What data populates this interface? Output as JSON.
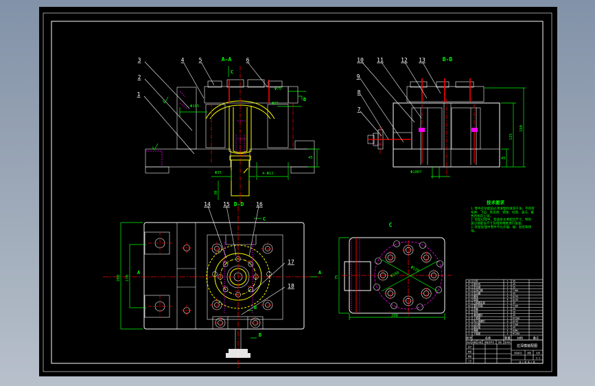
{
  "app": {
    "kind": "CAD assembly drawing preview",
    "background": "blue-gray",
    "canvas": "black"
  },
  "palette": {
    "green": "#00ff00",
    "red": "#ff0000",
    "yellow": "#ffff00",
    "cyan": "#00e8e8",
    "magenta": "#ff00ff",
    "white": "#ffffff",
    "bg_top": "#8292a8",
    "bg_bottom": "#b7c0cb",
    "canvas": "#000000"
  },
  "callouts": {
    "c1": "1",
    "c2": "2",
    "c3": "3",
    "c4": "4",
    "c5": "5",
    "c6": "6",
    "c7": "7",
    "c8": "8",
    "c9": "9",
    "c10": "10",
    "c11": "11",
    "c12": "12",
    "c13": "13",
    "c14": "14",
    "c15": "15",
    "c16": "16",
    "c17": "17",
    "c18": "18"
  },
  "section_labels": {
    "aa": "A-A",
    "bb": "B-B",
    "dd": "D-D",
    "view_c": "C",
    "cut_c_top": "C",
    "cut_c_plan": "C",
    "cut_a_left": "A",
    "cut_a_right": "A",
    "cut_b_1": "B",
    "cut_b_2": "B",
    "cut_b_aa": "B"
  },
  "dimensions": {
    "aa_bore": "Φ105",
    "aa_flange": "Φ75",
    "aa_inner": "Φ25",
    "aa_shank": "Φ35",
    "aa_holes": "4-Φ12",
    "aa_step": "45",
    "aa_shank_len": "30",
    "bb_height1": "125",
    "bb_height2": "190",
    "bb_step": "45",
    "bb_pin": "Φ10H7",
    "plan_width": "280",
    "plan_inner": "170",
    "c_bolt_circle1": "Φ160",
    "c_bolt_circle2": "Φ128",
    "c_side": "75",
    "c_length": "208"
  },
  "notes": {
    "title": "技术要求",
    "lines": [
      "1.零件在装配前必须清理和清洗干净，不得有",
      "毛刺、飞边、氧化皮、锈蚀、切屑、油污、着",
      "色剂和灰尘等。",
      "2.装配过程中，检查各主要配合尺寸，特别",
      "是过渡配合尺寸及相关精度进行复查。",
      "3.装配处理中零件不允许磕、碰、划伤和锈",
      "蚀。"
    ]
  },
  "bom": {
    "headers": {
      "no": "序号",
      "name": "名称",
      "qty": "数量",
      "mat": "材料",
      "note": "备注"
    },
    "rows": [
      {
        "no": "18",
        "name": "打杆",
        "qty": "1",
        "mat": "45",
        "note": ""
      },
      {
        "no": "17",
        "name": "推件块",
        "qty": "1",
        "mat": "45",
        "note": ""
      },
      {
        "no": "16",
        "name": "定位销",
        "qty": "2",
        "mat": "35",
        "note": ""
      },
      {
        "no": "15",
        "name": "拉深凸模",
        "qty": "1",
        "mat": "T10A",
        "note": ""
      },
      {
        "no": "14",
        "name": "压边圈",
        "qty": "1",
        "mat": "45",
        "note": ""
      },
      {
        "no": "13",
        "name": "螺母",
        "qty": "4",
        "mat": "Q235",
        "note": ""
      },
      {
        "no": "12",
        "name": "垫圈",
        "qty": "4",
        "mat": "Q235",
        "note": ""
      },
      {
        "no": "11",
        "name": "凸模固定板",
        "qty": "1",
        "mat": "45",
        "note": ""
      },
      {
        "no": "10",
        "name": "落料凹模",
        "qty": "1",
        "mat": "T10A",
        "note": ""
      },
      {
        "no": "9",
        "name": "导套",
        "qty": "2",
        "mat": "20",
        "note": ""
      },
      {
        "no": "8",
        "name": "导柱",
        "qty": "2",
        "mat": "20",
        "note": ""
      },
      {
        "no": "7",
        "name": "紧固螺钉",
        "qty": "1",
        "mat": "45",
        "note": ""
      },
      {
        "no": "6",
        "name": "上模座",
        "qty": "1",
        "mat": "HT200",
        "note": ""
      },
      {
        "no": "5",
        "name": "内六角螺钉",
        "qty": "4",
        "mat": "Q235",
        "note": ""
      },
      {
        "no": "4",
        "name": "凸凹模",
        "qty": "1",
        "mat": "T10A",
        "note": ""
      },
      {
        "no": "3",
        "name": "固定板",
        "qty": "1",
        "mat": "45",
        "note": ""
      },
      {
        "no": "2",
        "name": "弹簧",
        "qty": "4",
        "mat": "65Mn",
        "note": ""
      },
      {
        "no": "1",
        "name": "下模座",
        "qty": "1",
        "mat": "HT200",
        "note": ""
      }
    ]
  },
  "title_block": {
    "rev": [
      "标记",
      "处数",
      "分区",
      "更改文件号",
      "签名",
      "年月日"
    ],
    "roles": [
      "设计",
      "校核",
      "审核",
      "工艺"
    ],
    "drawing_name": "拉深模装配图",
    "stage_label": "阶段标记",
    "weight_label": "重量",
    "scale_label": "比例",
    "scale": "1:1",
    "sheet": "共 1 张 第 1 张"
  }
}
